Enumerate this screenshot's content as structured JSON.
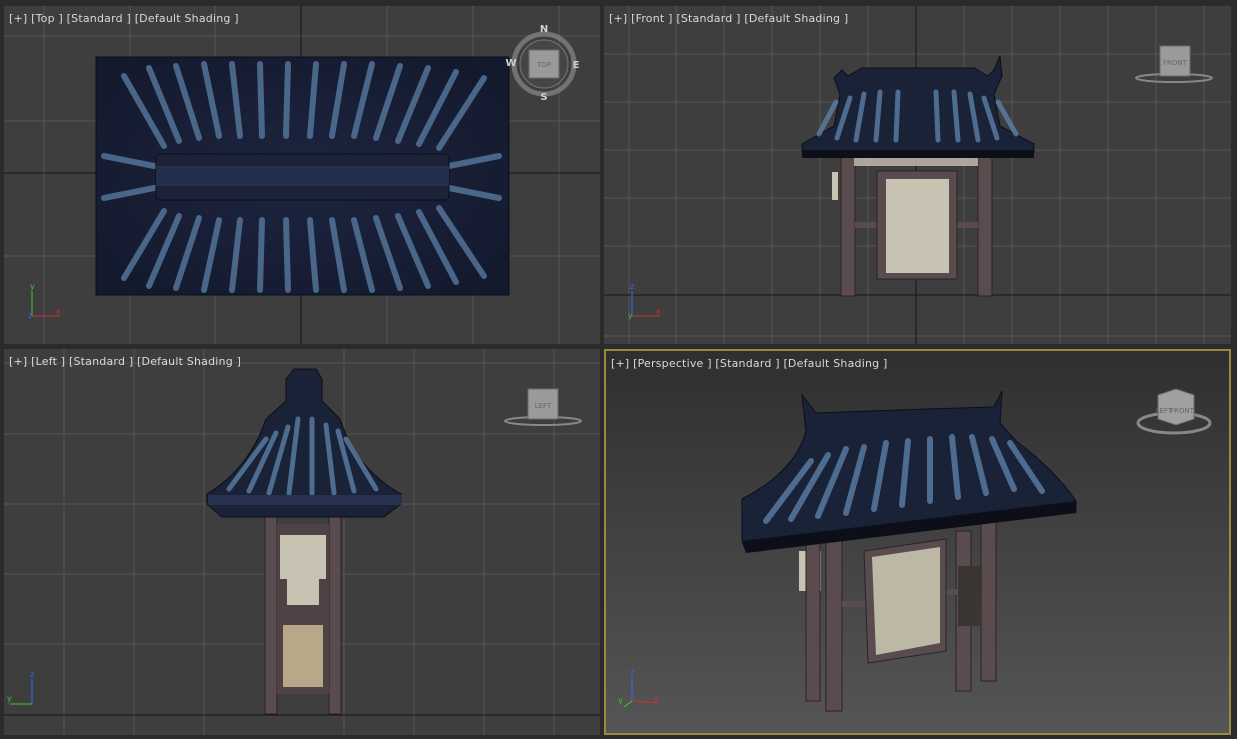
{
  "viewports": {
    "top": {
      "label_plus": "[+]",
      "label_view": "[Top ]",
      "label_mode": "[Standard ]",
      "label_shading": "[Default Shading ]",
      "compass": {
        "n": "N",
        "s": "S",
        "e": "E",
        "w": "W",
        "cube": "TOP"
      },
      "axes": {
        "a": "y",
        "b": "x",
        "c": "z"
      }
    },
    "front": {
      "label_plus": "[+]",
      "label_view": "[Front ]",
      "label_mode": "[Standard ]",
      "label_shading": "[Default Shading ]",
      "cube": "FRONT",
      "axes": {
        "a": "z",
        "b": "x",
        "c": "y"
      }
    },
    "left": {
      "label_plus": "[+]",
      "label_view": "[Left ]",
      "label_mode": "[Standard ]",
      "label_shading": "[Default Shading ]",
      "cube": "LEFT",
      "axes": {
        "a": "z",
        "b": "y"
      }
    },
    "perspective": {
      "label_plus": "[+]",
      "label_view": "[Perspective ]",
      "label_mode": "[Standard ]",
      "label_shading": "[Default Shading ]",
      "cube": "FRONT",
      "cube_side": "LEFT",
      "axes": {
        "a": "z",
        "b": "x",
        "c": "y"
      }
    }
  },
  "colors": {
    "viewport_bg": "#3e3e3e",
    "grid": "#555555",
    "grid_axis": "#141414",
    "active_border": "#9a8a3c",
    "roof_dark": "#1a2238",
    "roof_highlight": "#5b7fa6",
    "wood": "#5a4c4e",
    "paper": "#c8c2b2"
  }
}
